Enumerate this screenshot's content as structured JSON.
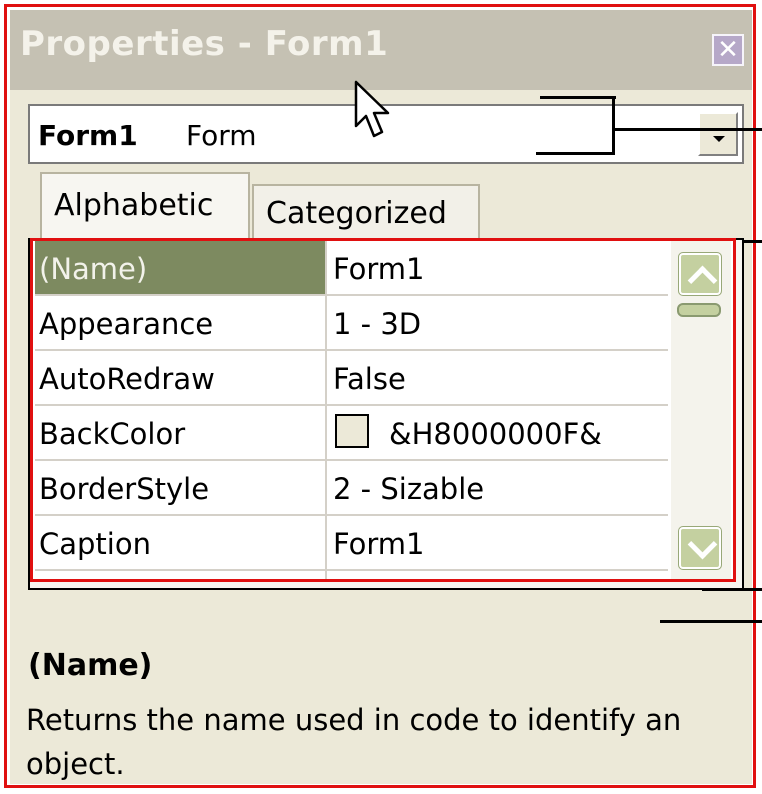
{
  "window": {
    "title": "Properties - Form1"
  },
  "object_selector": {
    "name": "Form1",
    "type": "Form"
  },
  "tabs": [
    {
      "label": "Alphabetic"
    },
    {
      "label": "Categorized"
    }
  ],
  "properties": [
    {
      "name": "(Name)",
      "value": "Form1"
    },
    {
      "name": "Appearance",
      "value": "1 - 3D"
    },
    {
      "name": "AutoRedraw",
      "value": "False"
    },
    {
      "name": "BackColor",
      "value": "&H8000000F&"
    },
    {
      "name": "BorderStyle",
      "value": "2 - Sizable"
    },
    {
      "name": "Caption",
      "value": "Form1"
    }
  ],
  "description": {
    "title": "(Name)",
    "text": "Returns the name used in code to identify an object."
  },
  "colors": {
    "selected_row": "#7d8a60",
    "highlight_frame": "#e01010",
    "backcolor_swatch": "#ece9d8"
  },
  "icons": [
    "close-icon",
    "dropdown-arrow-icon",
    "scroll-up-icon",
    "scroll-down-icon",
    "mouse-cursor-icon"
  ]
}
